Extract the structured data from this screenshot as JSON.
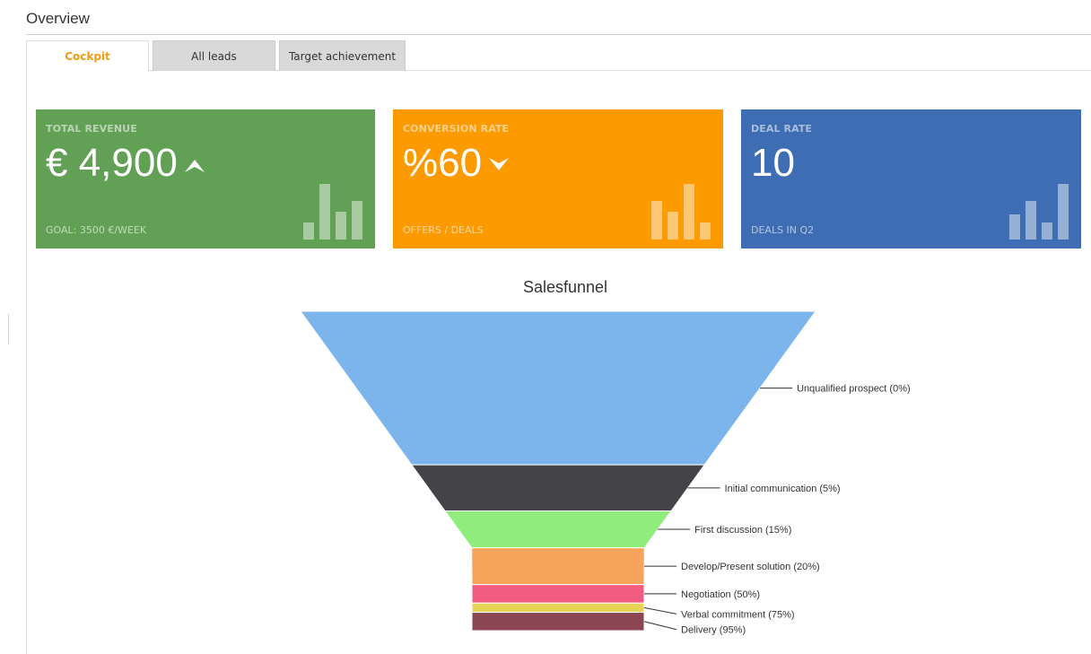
{
  "page": {
    "title": "Overview"
  },
  "tabs": [
    {
      "label": "Cockpit",
      "active": true
    },
    {
      "label": "All leads",
      "active": false
    },
    {
      "label": "Target achievement",
      "active": false
    }
  ],
  "kpis": {
    "revenue": {
      "label": "TOTAL REVENUE",
      "value": "€ 4,900",
      "trend_icon": "arrow-up-icon",
      "sub": "GOAL: 3500 €/WEEK",
      "color": "#62a155",
      "bars": [
        0.3,
        1.0,
        0.5,
        0.7
      ]
    },
    "conversion": {
      "label": "CONVERSION RATE",
      "value": "%60",
      "trend_icon": "arrow-down-icon",
      "sub": "OFFERS / DEALS",
      "color": "#fc9a00",
      "bars": [
        0.7,
        0.5,
        1.0,
        0.3
      ]
    },
    "deal": {
      "label": "DEAL RATE",
      "value": "10",
      "sub": "DEALS IN Q2",
      "color": "#3f6db3",
      "bars": [
        0.45,
        0.7,
        0.3,
        1.0
      ]
    }
  },
  "chart_data": {
    "type": "funnel",
    "title": "Salesfunnel",
    "stages": [
      {
        "label": "Unqualified prospect (0%)",
        "value": 100,
        "color": "#7cb5ec"
      },
      {
        "label": "Initial communication (5%)",
        "value": 30,
        "color": "#434348"
      },
      {
        "label": "First discussion (15%)",
        "value": 24,
        "color": "#90ed7d"
      },
      {
        "label": "Develop/Present solution (20%)",
        "value": 24,
        "color": "#f7a35c"
      },
      {
        "label": "Negotiation (50%)",
        "value": 12,
        "color": "#f15c80"
      },
      {
        "label": "Verbal commitment (75%)",
        "value": 6,
        "color": "#e4d354"
      },
      {
        "label": "Delivery (95%)",
        "value": 12,
        "color": "#8d4653"
      }
    ]
  }
}
